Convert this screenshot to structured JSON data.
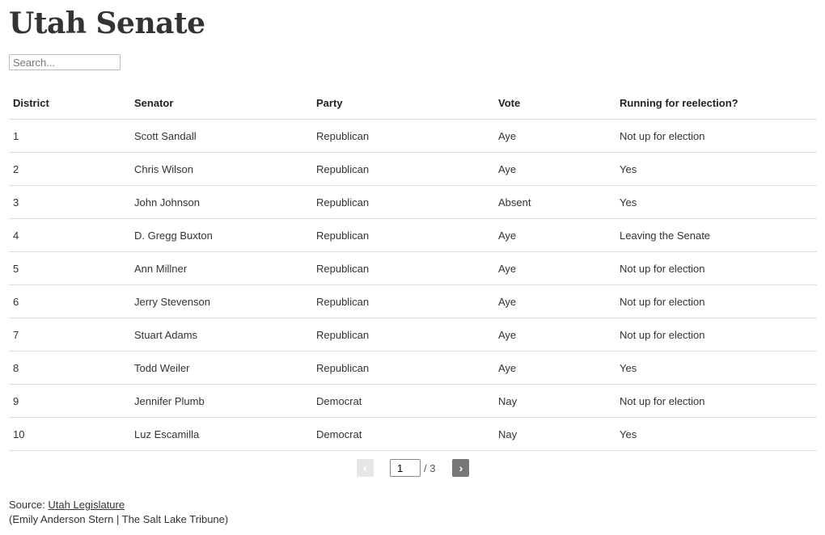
{
  "title": "Utah Senate",
  "search": {
    "placeholder": "Search..."
  },
  "table": {
    "headers": [
      "District",
      "Senator",
      "Party",
      "Vote",
      "Running for reelection?"
    ],
    "rows": [
      [
        "1",
        "Scott Sandall",
        "Republican",
        "Aye",
        "Not up for election"
      ],
      [
        "2",
        "Chris Wilson",
        "Republican",
        "Aye",
        "Yes"
      ],
      [
        "3",
        "John Johnson",
        "Republican",
        "Absent",
        "Yes"
      ],
      [
        "4",
        "D. Gregg Buxton",
        "Republican",
        "Aye",
        "Leaving the Senate"
      ],
      [
        "5",
        "Ann Millner",
        "Republican",
        "Aye",
        "Not up for election"
      ],
      [
        "6",
        "Jerry Stevenson",
        "Republican",
        "Aye",
        "Not up for election"
      ],
      [
        "7",
        "Stuart Adams",
        "Republican",
        "Aye",
        "Not up for election"
      ],
      [
        "8",
        "Todd Weiler",
        "Republican",
        "Aye",
        "Yes"
      ],
      [
        "9",
        "Jennifer Plumb",
        "Democrat",
        "Nay",
        "Not up for election"
      ],
      [
        "10",
        "Luz Escamilla",
        "Democrat",
        "Nay",
        "Yes"
      ]
    ]
  },
  "pagination": {
    "prev_icon": "‹",
    "next_icon": "›",
    "current_page": "1",
    "total_label": "/ 3"
  },
  "source": {
    "prefix": "Source: ",
    "link_text": "Utah Legislature",
    "credit": "(Emily Anderson Stern | The Salt Lake Tribune)"
  }
}
